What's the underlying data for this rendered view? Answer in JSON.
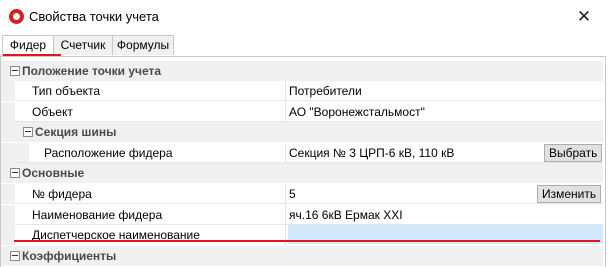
{
  "window": {
    "title": "Свойства точки учета",
    "close_glyph": "✕"
  },
  "tabs": [
    {
      "label": "Фидер",
      "active": true
    },
    {
      "label": "Счетчик",
      "active": false
    },
    {
      "label": "Формулы",
      "active": false
    }
  ],
  "sections": {
    "location": {
      "title": "Положение точки учета",
      "object_type": {
        "label": "Тип объекта",
        "value": "Потребители"
      },
      "object": {
        "label": "Объект",
        "value": "АО \"Воронежстальмост\""
      }
    },
    "bus_section": {
      "title": "Секция шины",
      "feeder_location": {
        "label": "Расположение фидера",
        "value": "Секция № 3 ЦРП-6 кВ, 110 кВ",
        "button": "Выбрать"
      }
    },
    "main": {
      "title": "Основные",
      "feeder_number": {
        "label": "№ фидера",
        "value": "5",
        "button": "Изменить"
      },
      "feeder_name": {
        "label": "Наименование фидера",
        "value": "яч.16 6кВ Ермак XXI"
      },
      "dispatch_name": {
        "label": "Диспетчерское наименование",
        "value": ""
      }
    },
    "coefficients": {
      "title": "Коэффициенты"
    }
  },
  "colors": {
    "accent_red": "#e8141b",
    "selected_field": "#cfe8fb",
    "section_bg": "#f0f0f0"
  }
}
